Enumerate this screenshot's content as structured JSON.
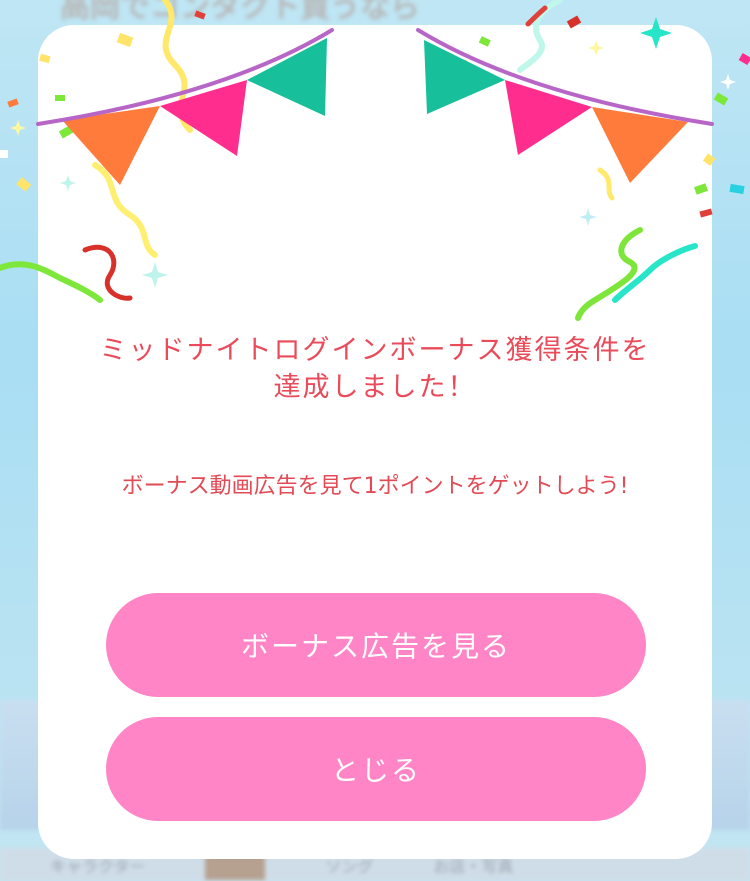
{
  "background": {
    "header_text": "高岡でコンタクト買うなら",
    "footer_items": [
      "キャラクター",
      "ソング",
      "お店・写真"
    ]
  },
  "dialog": {
    "title_line1": "ミッドナイトログインボーナス獲得条件を",
    "title_line2": "達成しました！",
    "subtitle": "ボーナス動画広告を見て1ポイントをゲットしよう!",
    "primary_button": "ボーナス広告を見る",
    "secondary_button": "とじる"
  },
  "colors": {
    "accent_text": "#e94b5a",
    "button": "#ff85c6",
    "flag_orange": "#ff7b3c",
    "flag_pink": "#ff2d8e",
    "flag_teal": "#17bf9a",
    "string": "#b766c7"
  },
  "decorations": [
    "bunting-left",
    "bunting-right",
    "confetti",
    "streamers",
    "sparkles"
  ]
}
